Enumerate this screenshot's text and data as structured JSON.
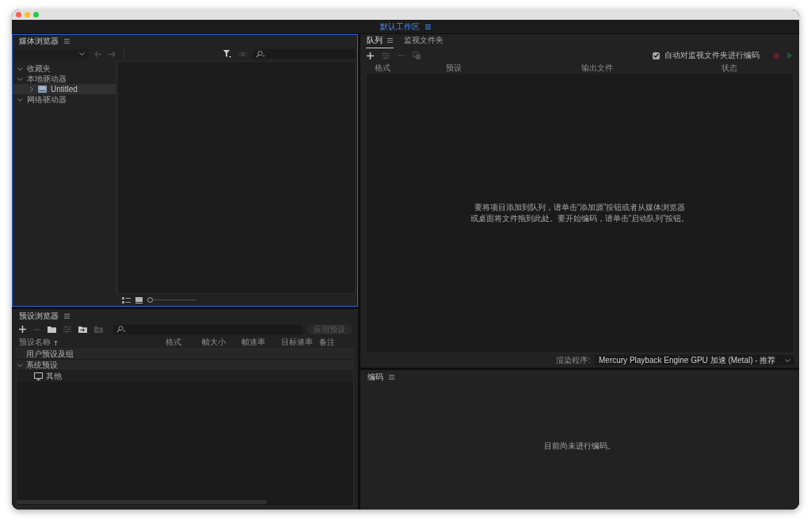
{
  "workspace_bar": {
    "label": "默认工作区"
  },
  "media_browser": {
    "title": "媒体浏览器",
    "focused": true,
    "navigation": [
      {
        "kind": "back",
        "disabled": true
      },
      {
        "kind": "forward",
        "disabled": true
      }
    ],
    "view_tools": [
      {
        "kind": "filter",
        "disabled": false
      },
      {
        "kind": "view",
        "disabled": true
      }
    ],
    "tree": [
      {
        "label": "收藏夹",
        "expanded": true,
        "selected": false
      },
      {
        "label": "本地驱动器",
        "expanded": true,
        "selected": false,
        "children": [
          {
            "label": "Untitled",
            "expanded": false,
            "selected": true
          }
        ]
      },
      {
        "label": "网络驱动器",
        "expanded": true,
        "selected": false
      }
    ],
    "thumbnail_size": {
      "level": 0
    }
  },
  "preset_browser": {
    "title": "预设浏览器",
    "focused": false,
    "toolbar": [
      {
        "kind": "add",
        "disabled": false
      },
      {
        "kind": "remove",
        "disabled": true
      },
      {
        "kind": "new_group",
        "disabled": false
      },
      {
        "kind": "settings",
        "disabled": true
      },
      {
        "kind": "import",
        "disabled": false
      },
      {
        "kind": "export",
        "disabled": true
      }
    ],
    "apply_button": {
      "label": "应用预设",
      "disabled": true
    },
    "columns": [
      {
        "label": "预设名称",
        "sorted": true
      },
      {
        "label": "格式",
        "sorted": false
      },
      {
        "label": "帧大小",
        "sorted": false
      },
      {
        "label": "帧速率",
        "sorted": false
      },
      {
        "label": "目标速率",
        "sorted": false
      },
      {
        "label": "备注",
        "sorted": false
      }
    ],
    "tree": [
      {
        "label": "用户预设及组",
        "kind": "group"
      },
      {
        "label": "系统预设",
        "kind": "group",
        "expanded": true,
        "children": [
          {
            "label": "其他",
            "kind": "device"
          }
        ]
      }
    ]
  },
  "queue_panel": {
    "focused": false,
    "tabs": [
      {
        "label": "队列",
        "selected": true
      },
      {
        "label": "监视文件夹",
        "selected": false
      }
    ],
    "toolbar": [
      {
        "kind": "add",
        "disabled": false
      },
      {
        "kind": "settings",
        "disabled": true
      },
      {
        "kind": "remove",
        "disabled": true
      },
      {
        "kind": "duplicate",
        "disabled": true
      }
    ],
    "auto_encode": {
      "label": "自动对监视文件夹进行编码",
      "checked": true
    },
    "controls": [
      {
        "kind": "stop",
        "disabled": true
      },
      {
        "kind": "start",
        "disabled": true
      }
    ],
    "columns": [
      "格式",
      "预设",
      "输出文件",
      "状态"
    ],
    "empty_message": "要将项目添加到队列，请单击“添加源”按钮或者从媒体浏览器或桌面将文件拖到此处。要开始编码，请单击“启动队列”按钮。",
    "renderer": {
      "label": "渲染程序:",
      "value": "Mercury Playback Engine GPU 加速 (Metal) - 推荐"
    }
  },
  "encoding_panel": {
    "title": "编码",
    "focused": false,
    "message": "目前尚未进行编码。"
  }
}
